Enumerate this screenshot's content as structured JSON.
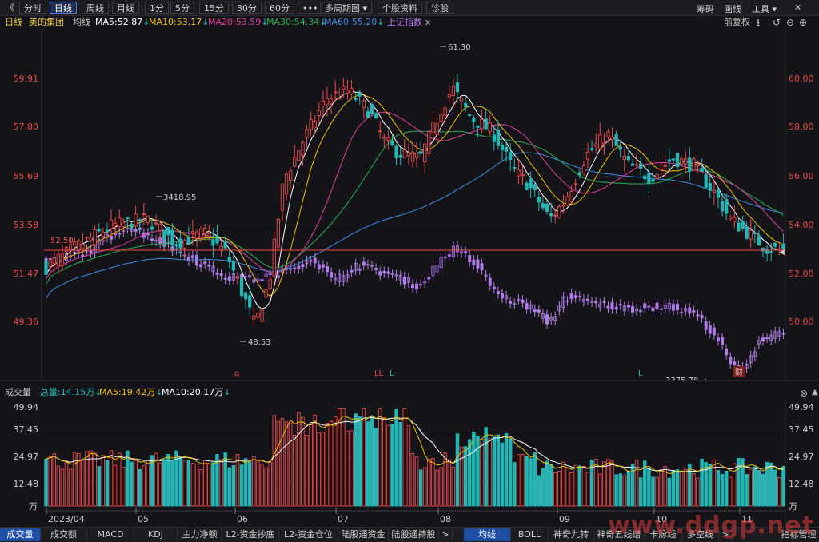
{
  "toolbar": {
    "back": "《",
    "buttons": [
      "分时",
      "日线",
      "周线",
      "月线",
      "1分",
      "5分",
      "15分",
      "30分",
      "60分",
      "•••",
      "多周期图 ▾",
      "个股资料",
      "诊股"
    ],
    "right": [
      "筹码",
      "画线",
      "工具 ▾",
      "✕"
    ],
    "expand": "⤡"
  },
  "info": {
    "period": "日线",
    "stock": "美的集团",
    "ma_label": "均线",
    "ma5": "MA5:52.87",
    "ma10": "MA10:53.17",
    "ma20": "MA20:53.59",
    "ma30": "MA30:54.34",
    "ma60": "MA60:55.20",
    "index": "上证指数",
    "close": "x",
    "adjust": "前复权"
  },
  "price_axis_left": [
    "59.91",
    "57.80",
    "55.69",
    "53.58",
    "51.47",
    "49.36"
  ],
  "price_axis_right": [
    "60.00",
    "58.00",
    "56.00",
    "54.00",
    "52.00",
    "50.00"
  ],
  "annotations": {
    "high": "61.30",
    "low": "48.53",
    "idx_high": "3418.95",
    "idx_low": "3375.78",
    "marker_left": "52.50",
    "q": "q",
    "l1": "LL",
    "l2": "L",
    "l3": "L",
    "cai": "财"
  },
  "volume": {
    "title": "成交量",
    "total": "总量:14.15万",
    "ma5": "MA5:19.42万",
    "ma10": "MA10:20.17万",
    "axis": [
      "49.94",
      "37.45",
      "24.97",
      "12.48"
    ],
    "unit": "万",
    "months": [
      "2023/04",
      "05",
      "06",
      "07",
      "08",
      "09",
      "10",
      "11"
    ]
  },
  "bottom_tabs": [
    "成交量",
    "成交额",
    "MACD",
    "KDJ",
    "主力净额",
    "L2-资金抄底",
    "L2-资金仓位",
    "陆股通资金",
    "陆股通持股",
    ">",
    "均线",
    "BOLL",
    "神奇九转",
    "神奇五线谱",
    "卡脉线",
    "多空线",
    ">",
    "指标管理"
  ],
  "watermark": "www.ddgp.net",
  "colors": {
    "up": "#f04848",
    "down": "#23b6b6",
    "ma5": "#ffffff",
    "ma10": "#f0c000",
    "ma20": "#e040a0",
    "ma30": "#26b050",
    "ma60": "#3a8ee6",
    "index": "#b07ce8"
  }
}
